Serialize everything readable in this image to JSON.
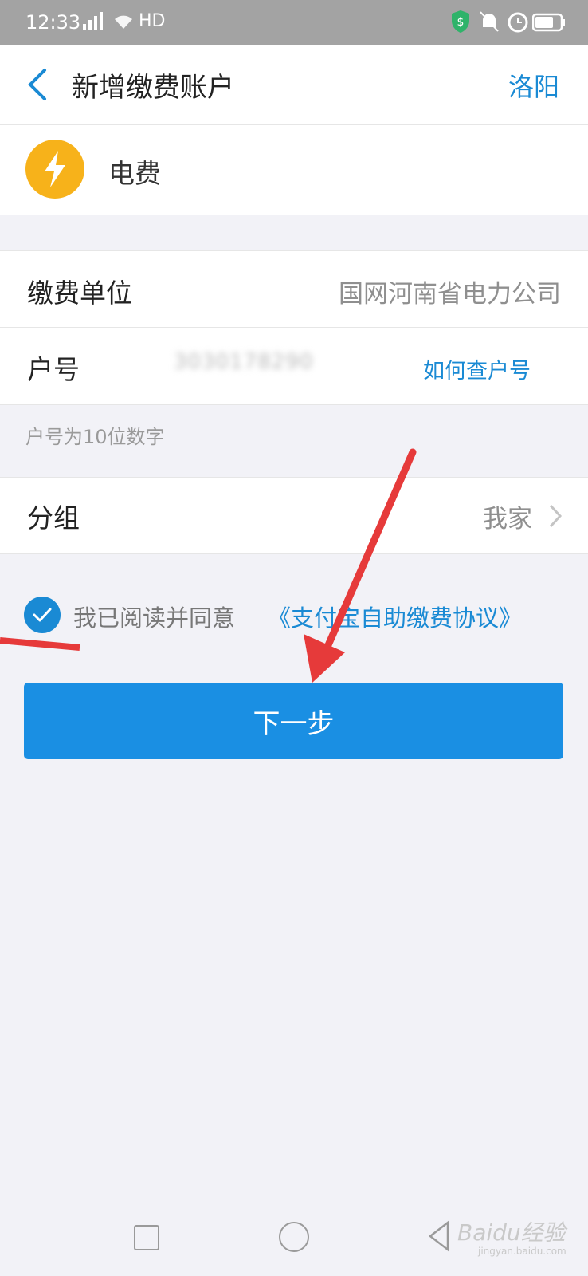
{
  "status_bar": {
    "time": "12:33",
    "network": "HD",
    "icons": [
      "signal-icon",
      "wifi-icon",
      "shield-icon",
      "mute-icon",
      "alarm-icon",
      "battery-icon"
    ]
  },
  "header": {
    "back_icon": "chevron-left-icon",
    "title": "新增缴费账户",
    "city": "洛阳"
  },
  "biller": {
    "icon": "lightning-icon",
    "name": "电费"
  },
  "form": {
    "unit_label": "缴费单位",
    "unit_value": "国网河南省电力公司",
    "account_label": "户号",
    "account_value": "3030178290",
    "help_link": "如何查户号"
  },
  "hint": "户号为10位数字",
  "group": {
    "label": "分组",
    "value": "我家"
  },
  "agreement": {
    "checked": true,
    "text": "我已阅读并同意",
    "link": "《支付宝自助缴费协议》"
  },
  "next_button": "下一步",
  "nav": {
    "watermark": "Baidu经验",
    "watermark_sub": "jingyan.baidu.com"
  },
  "colors": {
    "accent": "#1a8ad4",
    "button": "#1a8fe3",
    "biller_icon_bg": "#f7b21a",
    "annotation": "#e63a3a"
  }
}
